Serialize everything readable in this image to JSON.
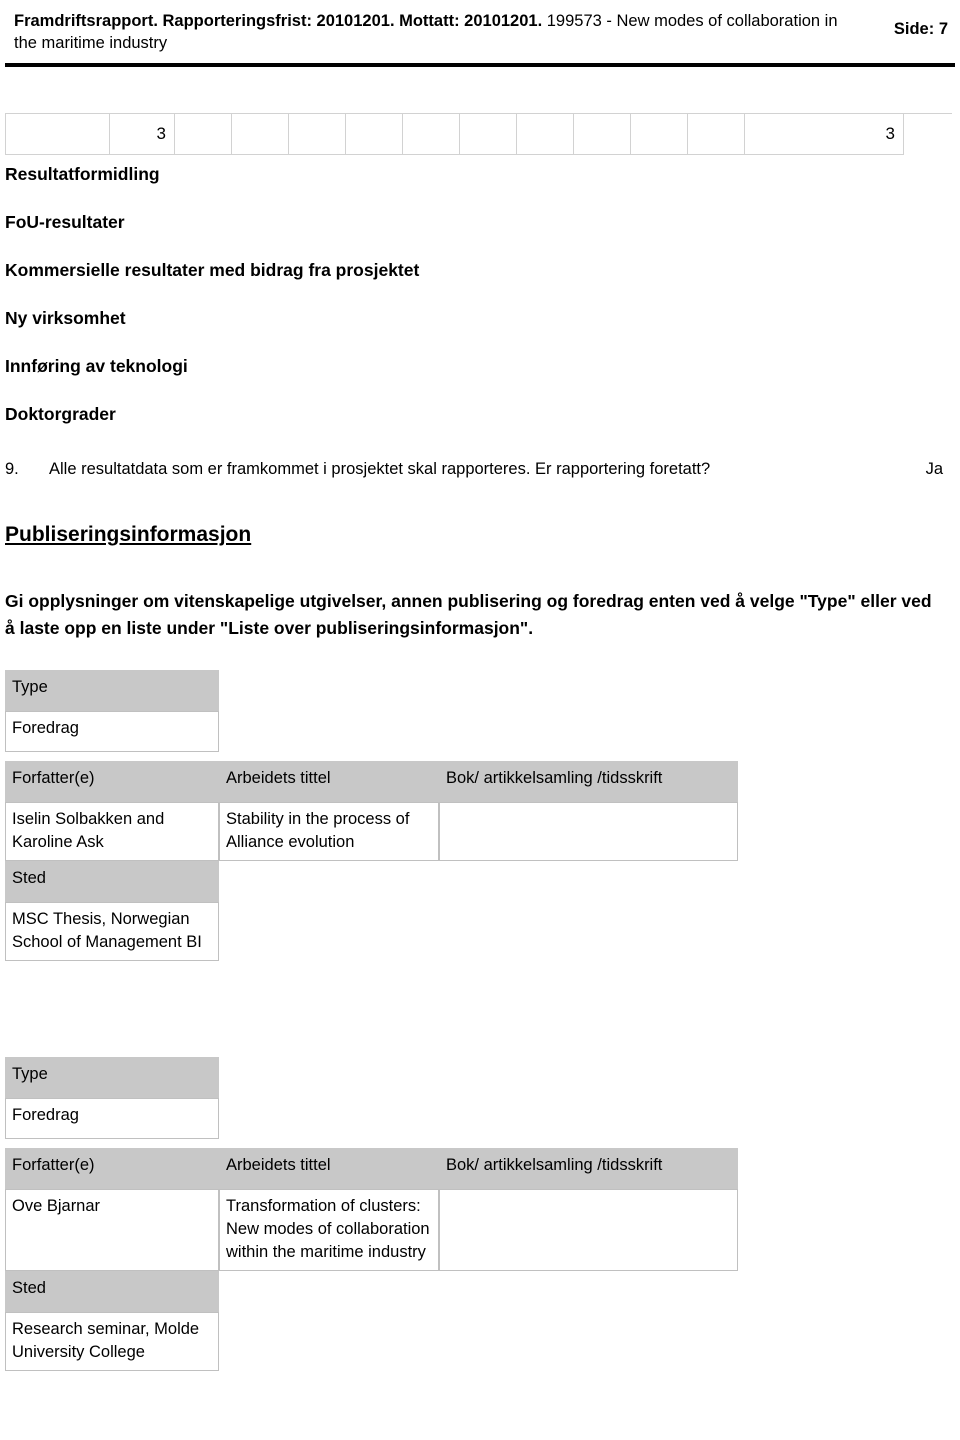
{
  "header": {
    "bold_part": "Framdriftsrapport. Rapporteringsfrist: 20101201. Mottatt: 20101201.",
    "normal_part": " 199573 - New modes of collaboration in the maritime industry",
    "page_label": "Side: 7"
  },
  "grid": {
    "cells": [
      "",
      "3",
      "",
      "",
      "",
      "",
      "",
      "",
      "",
      "",
      "",
      "",
      "3"
    ],
    "widths": [
      105,
      65,
      57,
      57,
      57,
      57,
      57,
      57,
      57,
      57,
      57,
      57,
      159
    ]
  },
  "headings": [
    "Resultatformidling",
    "FoU-resultater",
    "Kommersielle resultater med bidrag fra prosjektet",
    "Ny virksomhet",
    "Innføring av teknologi",
    "Doktorgrader"
  ],
  "question": {
    "number": "9.",
    "text": "Alle resultatdata som er framkommet i prosjektet skal rapporteres. Er rapportering foretatt?",
    "answer": "Ja"
  },
  "section_title": "Publiseringsinformasjon",
  "instruction": "Gi opplysninger om vitenskapelige utgivelser, annen publisering og foredrag enten ved å velge \"Type\" eller ved å laste opp en liste under \"Liste over publiseringsinformasjon\".",
  "publications": [
    {
      "type_label": "Type",
      "type_value": "Foredrag",
      "col_headers": [
        "Forfatter(e)",
        "Arbeidets tittel",
        "Bok/ artikkelsamling /tidsskrift"
      ],
      "author": "Iselin Solbakken and Karoline Ask",
      "title": "Stability in the process of Alliance evolution",
      "book": "",
      "sted_label": "Sted",
      "sted_value": "MSC Thesis, Norwegian School of Management BI"
    },
    {
      "type_label": "Type",
      "type_value": "Foredrag",
      "col_headers": [
        "Forfatter(e)",
        "Arbeidets tittel",
        "Bok/ artikkelsamling /tidsskrift"
      ],
      "author": "Ove Bjarnar",
      "title": "Transformation of clusters: New modes of collaboration within the maritime industry",
      "book": "",
      "sted_label": "Sted",
      "sted_value": "Research seminar, Molde University College"
    }
  ]
}
